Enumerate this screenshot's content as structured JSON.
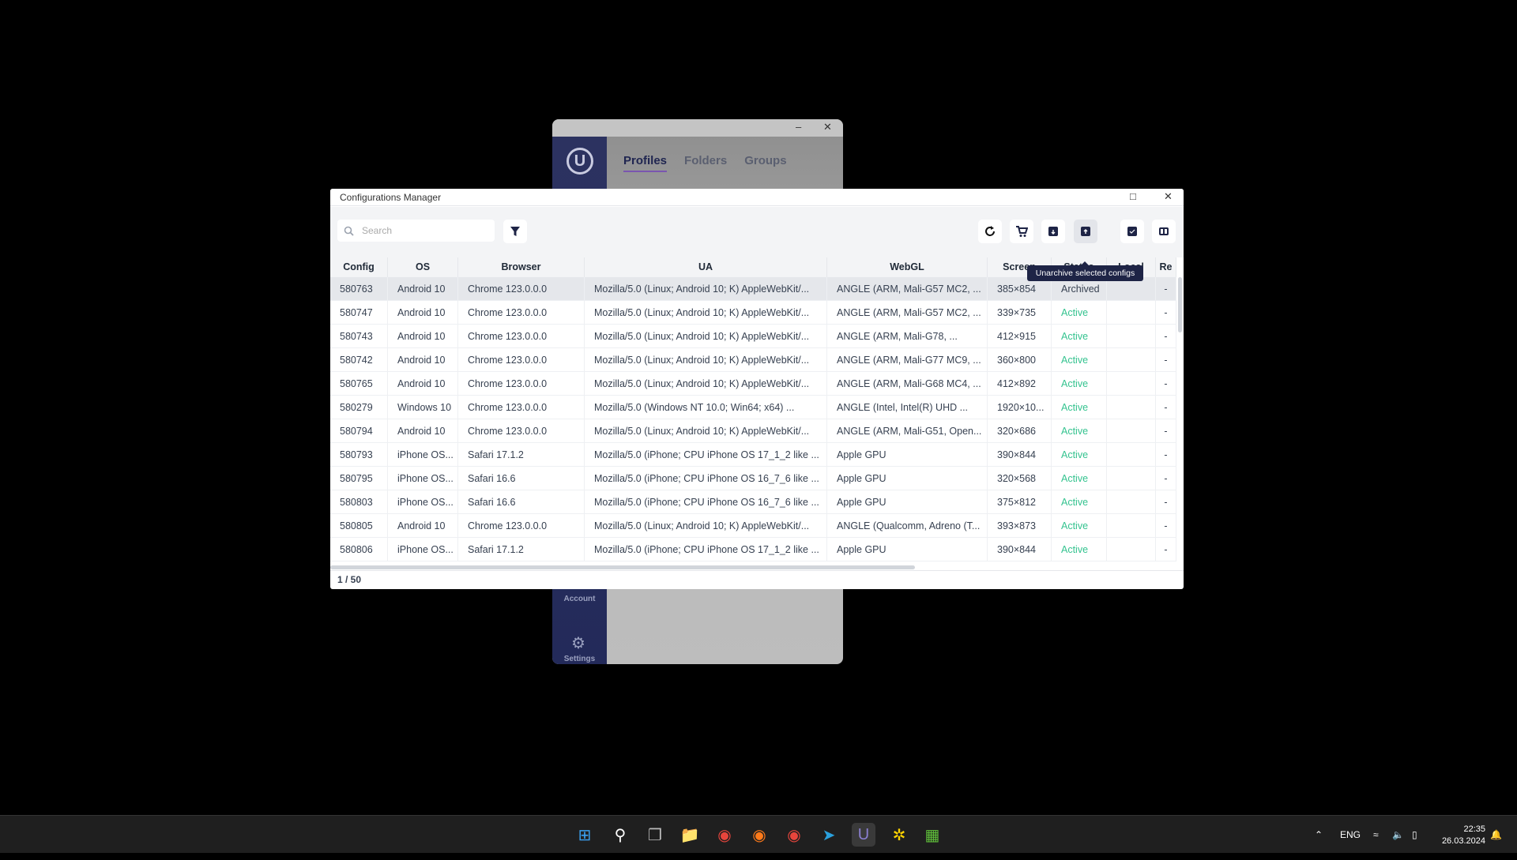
{
  "bg_app": {
    "tabs": [
      "Profiles",
      "Folders",
      "Groups"
    ],
    "sidebar": {
      "account": "Account",
      "settings": "Settings"
    }
  },
  "dialog": {
    "title": "Configurations Manager",
    "search": {
      "placeholder": "Search",
      "value": ""
    },
    "tooltip": "Unarchive selected configs",
    "toolbar_icons": [
      "refresh-icon",
      "cart-icon",
      "archive-icon",
      "unarchive-icon",
      "select-all-icon",
      "columns-icon"
    ],
    "columns": [
      "Config",
      "OS",
      "Browser",
      "UA",
      "WebGL",
      "Screen",
      "Status",
      "Local",
      "Re"
    ],
    "rows": [
      [
        "580763",
        "Android 10",
        "Chrome 123.0.0.0",
        "Mozilla/5.0 (Linux; Android 10; K) AppleWebKit/...",
        "ANGLE (ARM, Mali-G57 MC2, ...",
        "385×854",
        "Archived",
        "",
        "-"
      ],
      [
        "580747",
        "Android 10",
        "Chrome 123.0.0.0",
        "Mozilla/5.0 (Linux; Android 10; K) AppleWebKit/...",
        "ANGLE (ARM, Mali-G57 MC2, ...",
        "339×735",
        "Active",
        "",
        "-"
      ],
      [
        "580743",
        "Android 10",
        "Chrome 123.0.0.0",
        "Mozilla/5.0 (Linux; Android 10; K) AppleWebKit/...",
        "ANGLE (ARM, Mali-G78, ...",
        "412×915",
        "Active",
        "",
        "-"
      ],
      [
        "580742",
        "Android 10",
        "Chrome 123.0.0.0",
        "Mozilla/5.0 (Linux; Android 10; K) AppleWebKit/...",
        "ANGLE (ARM, Mali-G77 MC9, ...",
        "360×800",
        "Active",
        "",
        "-"
      ],
      [
        "580765",
        "Android 10",
        "Chrome 123.0.0.0",
        "Mozilla/5.0 (Linux; Android 10; K) AppleWebKit/...",
        "ANGLE (ARM, Mali-G68 MC4, ...",
        "412×892",
        "Active",
        "",
        "-"
      ],
      [
        "580279",
        "Windows 10",
        "Chrome 123.0.0.0",
        "Mozilla/5.0 (Windows NT 10.0; Win64; x64) ...",
        "ANGLE (Intel, Intel(R) UHD ...",
        "1920×10...",
        "Active",
        "",
        "-"
      ],
      [
        "580794",
        "Android 10",
        "Chrome 123.0.0.0",
        "Mozilla/5.0 (Linux; Android 10; K) AppleWebKit/...",
        "ANGLE (ARM, Mali-G51, Open...",
        "320×686",
        "Active",
        "",
        "-"
      ],
      [
        "580793",
        "iPhone OS...",
        "Safari 17.1.2",
        "Mozilla/5.0 (iPhone; CPU iPhone OS 17_1_2 like ...",
        "Apple GPU",
        "390×844",
        "Active",
        "",
        "-"
      ],
      [
        "580795",
        "iPhone OS...",
        "Safari 16.6",
        "Mozilla/5.0 (iPhone; CPU iPhone OS 16_7_6 like ...",
        "Apple GPU",
        "320×568",
        "Active",
        "",
        "-"
      ],
      [
        "580803",
        "iPhone OS...",
        "Safari 16.6",
        "Mozilla/5.0 (iPhone; CPU iPhone OS 16_7_6 like ...",
        "Apple GPU",
        "375×812",
        "Active",
        "",
        "-"
      ],
      [
        "580805",
        "Android 10",
        "Chrome 123.0.0.0",
        "Mozilla/5.0 (Linux; Android 10; K) AppleWebKit/...",
        "ANGLE (Qualcomm, Adreno (T...",
        "393×873",
        "Active",
        "",
        "-"
      ],
      [
        "580806",
        "iPhone OS...",
        "Safari 17.1.2",
        "Mozilla/5.0 (iPhone; CPU iPhone OS 17_1_2 like ...",
        "Apple GPU",
        "390×844",
        "Active",
        "",
        "-"
      ]
    ],
    "pagination": "1 / 50",
    "colors": {
      "active": "#34c38f",
      "archived": "#374151",
      "navy": "#1e2446"
    }
  },
  "taskbar": {
    "apps": [
      "windows-start-icon",
      "search-icon",
      "task-view-icon",
      "file-explorer-icon",
      "chrome-icon",
      "firefox-icon",
      "chrome-profile-icon",
      "telegram-icon",
      "undetectable-icon",
      "app-icon",
      "notepad-icon"
    ],
    "lang": "ENG",
    "time": "22:35",
    "date": "26.03.2024"
  }
}
